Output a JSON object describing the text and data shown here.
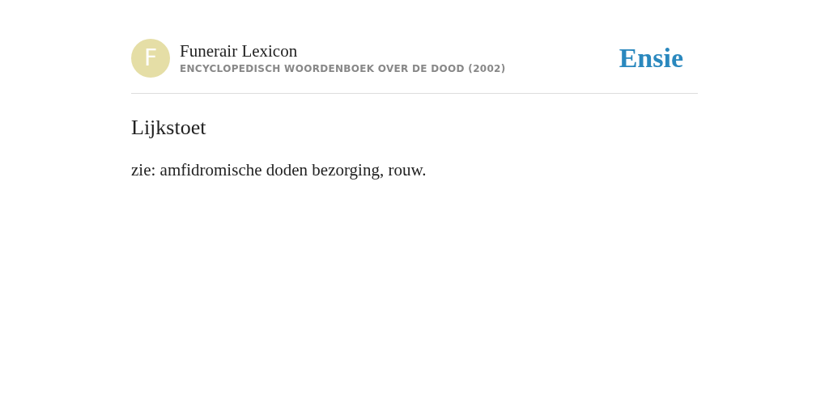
{
  "header": {
    "avatar_letter": "F",
    "title": "Funerair Lexicon",
    "subtitle": "ENCYCLOPEDISCH WOORDENBOEK OVER DE DOOD (2002)",
    "logo": "Ensie"
  },
  "entry": {
    "heading": "Lijkstoet",
    "body": "zie: amfidromische doden bezorging, rouw."
  }
}
